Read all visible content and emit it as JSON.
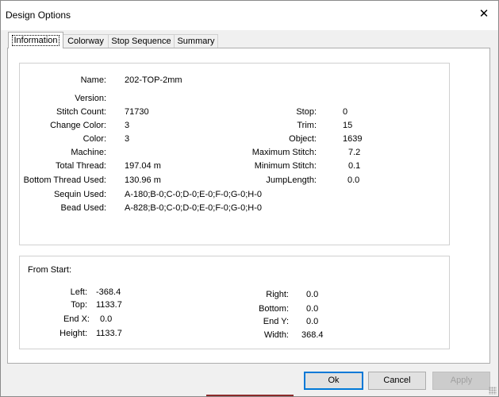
{
  "window": {
    "title": "Design Options",
    "close_glyph": "✕"
  },
  "tabs": [
    {
      "label": "Information",
      "active": true
    },
    {
      "label": "Colorway"
    },
    {
      "label": "Stop Sequence"
    },
    {
      "label": "Summary"
    }
  ],
  "info": {
    "name": {
      "label": "Name:",
      "value": "202-TOP-2mm"
    },
    "version": {
      "label": "Version:",
      "value": ""
    },
    "stitch_count": {
      "label": "Stitch Count:",
      "value": "71730"
    },
    "change_color": {
      "label": "Change Color:",
      "value": "3"
    },
    "color": {
      "label": "Color:",
      "value": "3"
    },
    "machine": {
      "label": "Machine:",
      "value": ""
    },
    "total_thread": {
      "label": "Total Thread:",
      "value": "197.04 m"
    },
    "bottom_thread": {
      "label": "Bottom Thread Used:",
      "value": "130.96 m"
    },
    "sequin_used": {
      "label": "Sequin Used:",
      "value": "A-180;B-0;C-0;D-0;E-0;F-0;G-0;H-0"
    },
    "bead_used": {
      "label": "Bead Used:",
      "value": "A-828;B-0;C-0;D-0;E-0;F-0;G-0;H-0"
    },
    "stop": {
      "label": "Stop:",
      "value": "0"
    },
    "trim": {
      "label": "Trim:",
      "value": "15"
    },
    "object": {
      "label": "Object:",
      "value": "1639"
    },
    "max_stitch": {
      "label": "Maximum Stitch:",
      "value": "7.2"
    },
    "min_stitch": {
      "label": "Minimum Stitch:",
      "value": "0.1"
    },
    "jump_length": {
      "label": "JumpLength:",
      "value": "0.0"
    }
  },
  "from_start": {
    "heading": "From Start:",
    "left": {
      "label": "Left:",
      "value": "-368.4"
    },
    "top": {
      "label": "Top:",
      "value": "1133.7"
    },
    "end_x": {
      "label": "End X:",
      "value": "0.0"
    },
    "height": {
      "label": "Height:",
      "value": "1133.7"
    },
    "right": {
      "label": "Right:",
      "value": "0.0"
    },
    "bottom": {
      "label": "Bottom:",
      "value": "0.0"
    },
    "end_y": {
      "label": "End Y:",
      "value": "0.0"
    },
    "width": {
      "label": "Width:",
      "value": "368.4"
    }
  },
  "buttons": {
    "ok": "Ok",
    "cancel": "Cancel",
    "apply": "Apply"
  },
  "colors": {
    "accent": "#0078d7",
    "disabled_text": "#a0a0a0"
  }
}
